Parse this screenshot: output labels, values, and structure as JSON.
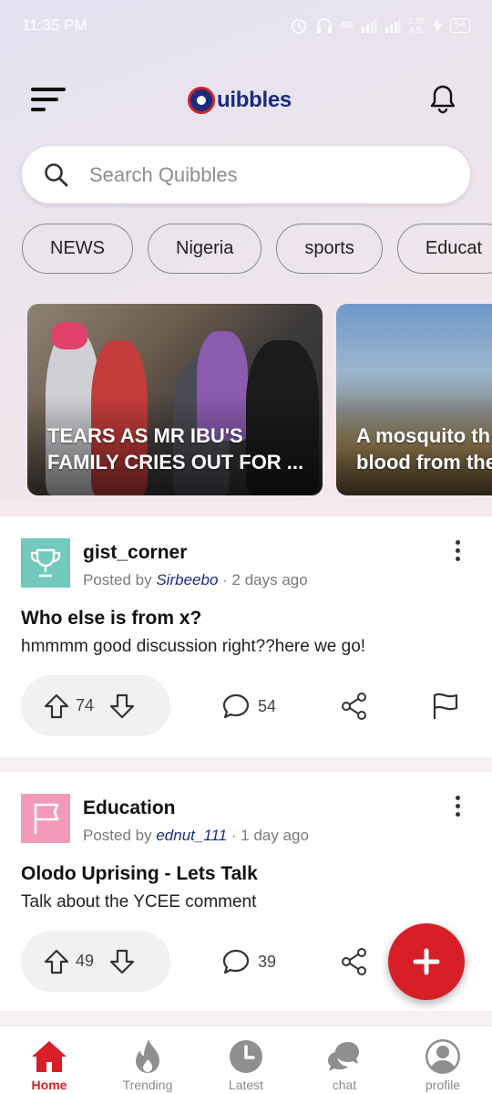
{
  "status_bar": {
    "time": "11:35 PM",
    "network": "4G",
    "speed": "1.90\nK/S",
    "battery": "54"
  },
  "header": {
    "logo_text": "uibbles",
    "brand_color": "#1a2b80",
    "accent_color": "#d71f27"
  },
  "search": {
    "placeholder": "Search Quibbles",
    "value": ""
  },
  "chips": [
    "NEWS",
    "Nigeria",
    "sports",
    "Educat"
  ],
  "stories": [
    {
      "title": "TEARS AS MR IBU'S\nFAMILY CRIES OUT FOR ..."
    },
    {
      "title": "A mosquito th\nblood from the"
    }
  ],
  "posts": [
    {
      "community": "gist_corner",
      "posted_by": "Posted by",
      "author": "Sirbeebo",
      "time": " · 2 days ago",
      "title": "Who else is from x?",
      "body": "hmmmm good discussion right??here we go!",
      "upvotes": "74",
      "comments": "54",
      "avatar_color": "#72c9bd",
      "avatar_icon": "trophy-icon"
    },
    {
      "community": "Education",
      "posted_by": "Posted by",
      "author": "ednut_111",
      "time": " · 1 day ago",
      "title": "Olodo Uprising - Lets Talk",
      "body": "Talk about the YCEE comment",
      "upvotes": "49",
      "comments": "39",
      "avatar_color": "#f39bb6",
      "avatar_icon": "flag-icon"
    }
  ],
  "bottom_nav": [
    {
      "label": "Home",
      "icon": "home-icon",
      "active": true
    },
    {
      "label": "Trending",
      "icon": "flame-icon",
      "active": false
    },
    {
      "label": "Latest",
      "icon": "clock-icon",
      "active": false
    },
    {
      "label": "chat",
      "icon": "chat-icon",
      "active": false
    },
    {
      "label": "profile",
      "icon": "profile-icon",
      "active": false
    }
  ]
}
